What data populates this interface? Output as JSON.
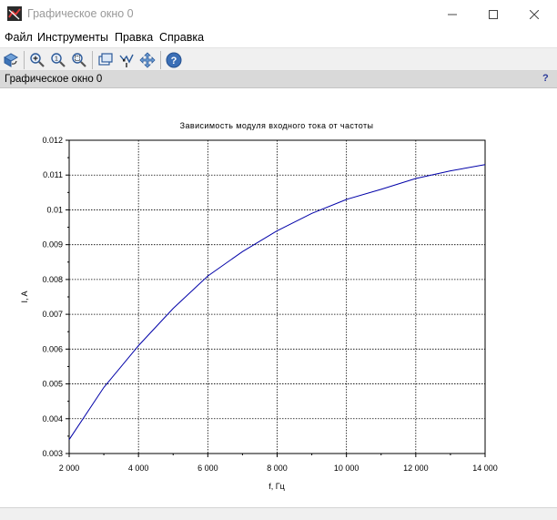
{
  "window": {
    "title": "Графическое окно 0"
  },
  "menu": {
    "items": [
      "Файл",
      "Инструменты",
      "Правка",
      "Справка"
    ]
  },
  "toolbar": {
    "icons": [
      "rotate-icon",
      "zoom-in-icon",
      "zoom-reset-icon",
      "zoom-area-icon",
      "datatip-icon",
      "edit-data-icon",
      "pan-icon",
      "help-icon"
    ]
  },
  "figure": {
    "header_label": "Графическое окно 0",
    "help_glyph": "?"
  },
  "colors": {
    "curve": "#0000a8",
    "grid": "#000000",
    "toolbar_bg": "#f0f0f0",
    "header_bg": "#d9d9d9"
  },
  "chart_data": {
    "type": "line",
    "title": "Зависимость модуля входного тока от частоты",
    "xlabel": "f, Гц",
    "ylabel": "I, A",
    "xlim": [
      2000,
      14000
    ],
    "ylim": [
      0.003,
      0.012
    ],
    "x_ticks": [
      2000,
      4000,
      6000,
      8000,
      10000,
      12000,
      14000
    ],
    "x_tick_labels": [
      "2 000",
      "4 000",
      "6 000",
      "8 000",
      "10 000",
      "12 000",
      "14 000"
    ],
    "y_ticks": [
      0.003,
      0.004,
      0.005,
      0.006,
      0.007,
      0.008,
      0.009,
      0.01,
      0.011,
      0.012
    ],
    "y_tick_labels": [
      "0.003",
      "0.004",
      "0.005",
      "0.006",
      "0.007",
      "0.008",
      "0.009",
      "0.01",
      "0.011",
      "0.012"
    ],
    "grid": true,
    "series": [
      {
        "x": [
          2000,
          3000,
          4000,
          5000,
          6000,
          7000,
          8000,
          9000,
          10000,
          11000,
          12000,
          13000,
          14000
        ],
        "values": [
          0.0034,
          0.0049,
          0.0061,
          0.00717,
          0.0081,
          0.0088,
          0.0094,
          0.0099,
          0.0103,
          0.01059,
          0.0109,
          0.01112,
          0.0113
        ]
      }
    ]
  }
}
